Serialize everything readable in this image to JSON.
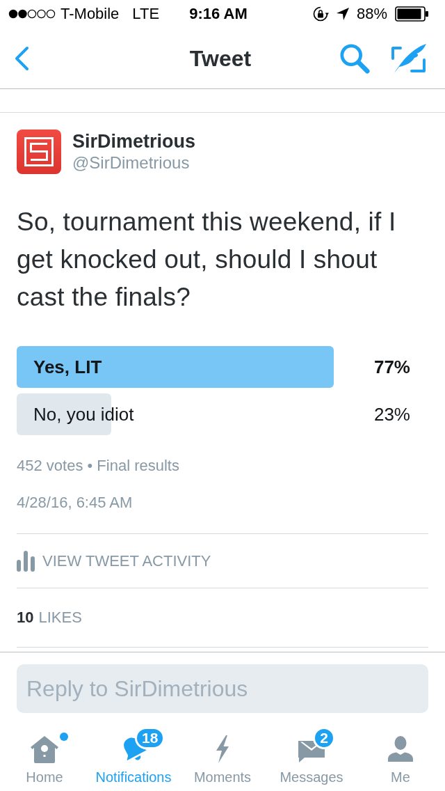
{
  "status_bar": {
    "carrier": "T-Mobile",
    "network": "LTE",
    "time": "9:16 AM",
    "battery": "88%"
  },
  "nav_bar": {
    "title": "Tweet"
  },
  "tweet": {
    "name": "SirDimetrious",
    "handle": "@SirDimetrious",
    "text": "So, tournament this weekend, if I get knocked out, should I shout cast the finals?",
    "poll": {
      "options": [
        {
          "label": "Yes, LIT",
          "percent": "77%",
          "level": 0.77,
          "winner": true
        },
        {
          "label": "No, you idiot",
          "percent": "23%",
          "level": 0.23,
          "winner": false
        }
      ],
      "summary": "452 votes • Final results"
    },
    "timestamp": "4/28/16, 6:45 AM"
  },
  "activity_link": "VIEW TWEET ACTIVITY",
  "likes": {
    "count": "10",
    "label": "LIKES"
  },
  "reply": {
    "placeholder": "Reply to SirDimetrious"
  },
  "tabs": [
    {
      "label": "Home",
      "selected": false,
      "dot": true
    },
    {
      "label": "Notifications",
      "selected": true,
      "dot": false,
      "badge": "18"
    },
    {
      "label": "Moments",
      "selected": false,
      "dot": false
    },
    {
      "label": "Messages",
      "selected": false,
      "dot": false,
      "badge": "2"
    },
    {
      "label": "Me",
      "selected": false,
      "dot": false
    }
  ]
}
